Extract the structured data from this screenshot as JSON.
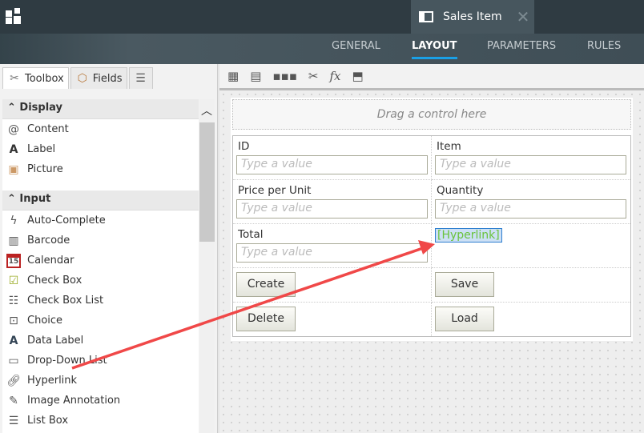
{
  "header": {
    "doc_tab": "Sales Item",
    "close": "✕"
  },
  "nav": {
    "tabs": [
      "GENERAL",
      "LAYOUT",
      "PARAMETERS",
      "RULES"
    ],
    "active": "LAYOUT"
  },
  "left": {
    "tabs": [
      "Toolbox",
      "Fields"
    ],
    "sections": [
      {
        "title": "Display",
        "items": [
          "Content",
          "Label",
          "Picture"
        ]
      },
      {
        "title": "Input",
        "items": [
          "Auto-Complete",
          "Barcode",
          "Calendar",
          "Check Box",
          "Check Box List",
          "Choice",
          "Data Label",
          "Drop-Down List",
          "Hyperlink",
          "Image Annotation",
          "List Box"
        ]
      }
    ]
  },
  "form": {
    "drag_hint": "Drag a control here",
    "placeholder": "Type a value",
    "labels": {
      "id": "ID",
      "item": "Item",
      "price": "Price per Unit",
      "quantity": "Quantity",
      "total": "Total"
    },
    "hyperlink": "[Hyperlink]",
    "buttons": {
      "create": "Create",
      "save": "Save",
      "delete": "Delete",
      "load": "Load"
    }
  },
  "colors": {
    "accent": "#1aa0e6",
    "annotation": "#f04848",
    "header": "#2f3b42"
  }
}
